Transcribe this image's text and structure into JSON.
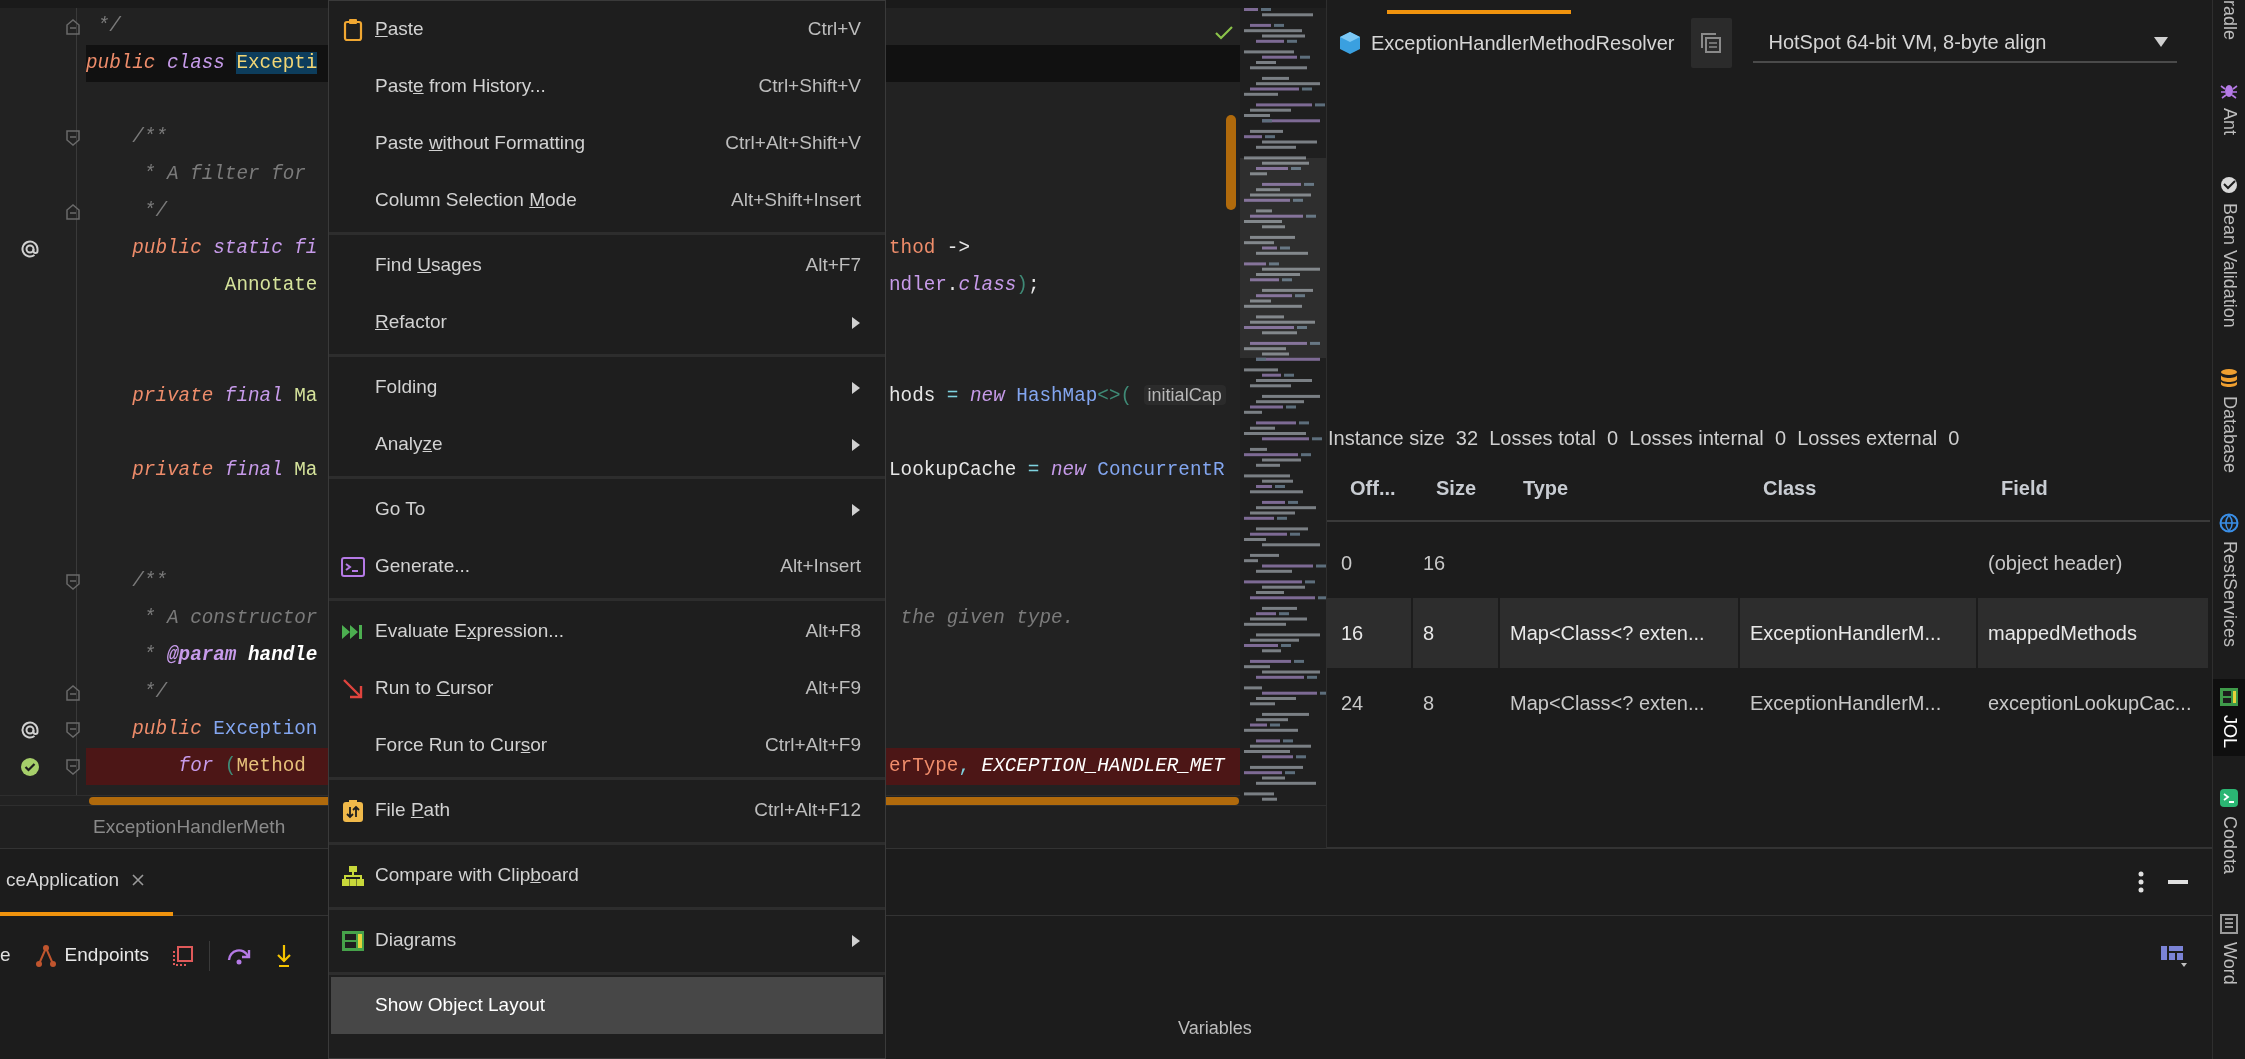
{
  "editor": {
    "lines": [
      {
        "left": [
          {
            "kind": "cm",
            "text": " */"
          }
        ],
        "current": false,
        "error": false,
        "fold": {
          "kind": "end"
        }
      },
      {
        "left": [
          {
            "kind": "kw",
            "text": "public "
          },
          {
            "kind": "mod",
            "text": "class "
          },
          {
            "kind": "sel",
            "text": "Excepti"
          }
        ],
        "current": true,
        "error": false
      },
      {
        "current": false,
        "error": false
      },
      {
        "left": [
          {
            "kind": "cm",
            "text": "    /**"
          }
        ],
        "current": false,
        "error": false,
        "fold": {
          "kind": "start"
        }
      },
      {
        "left": [
          {
            "kind": "cm",
            "text": "     * A filter for"
          }
        ],
        "current": false,
        "error": false
      },
      {
        "left": [
          {
            "kind": "cm",
            "text": "     */"
          }
        ],
        "current": false,
        "error": false,
        "fold": {
          "kind": "end"
        }
      },
      {
        "left": [
          {
            "kind": "kw",
            "text": "    public "
          },
          {
            "kind": "mod",
            "text": "static fi"
          }
        ],
        "right": [
          {
            "kind": "par",
            "text": "thod "
          },
          {
            "kind": "pl",
            "text": "->"
          }
        ],
        "current": false,
        "error": false,
        "gutter": {
          "kind": "annotation"
        }
      },
      {
        "left": [
          {
            "kind": "ann",
            "text": "            Annotate"
          }
        ],
        "right": [
          {
            "kind": "pv",
            "text": "ndler"
          },
          {
            "kind": "pl",
            "text": "."
          },
          {
            "kind": "mod",
            "text": "class"
          },
          {
            "kind": "br",
            "text": ")"
          },
          {
            "kind": "pl",
            "text": ";"
          }
        ],
        "current": false,
        "error": false
      },
      {
        "current": false,
        "error": false
      },
      {
        "current": false,
        "error": false
      },
      {
        "left": [
          {
            "kind": "kw",
            "text": "    private "
          },
          {
            "kind": "mod",
            "text": "final "
          },
          {
            "kind": "ann",
            "text": "Ma"
          }
        ],
        "right": [
          {
            "kind": "pl",
            "text": "hods "
          },
          {
            "kind": "op",
            "text": "= "
          },
          {
            "kind": "mod",
            "text": "new "
          },
          {
            "kind": "cls",
            "text": "HashMap"
          },
          {
            "kind": "br",
            "text": "<>( "
          },
          {
            "kind": "inl",
            "text": "initialCap"
          }
        ],
        "current": false,
        "error": false
      },
      {
        "current": false,
        "error": false
      },
      {
        "left": [
          {
            "kind": "kw",
            "text": "    private "
          },
          {
            "kind": "mod",
            "text": "final "
          },
          {
            "kind": "ann",
            "text": "Ma"
          }
        ],
        "right": [
          {
            "kind": "pl",
            "text": "LookupCache "
          },
          {
            "kind": "op",
            "text": "= "
          },
          {
            "kind": "mod",
            "text": "new "
          },
          {
            "kind": "cls",
            "text": "ConcurrentR"
          }
        ],
        "current": false,
        "error": false
      },
      {
        "current": false,
        "error": false
      },
      {
        "current": false,
        "error": false
      },
      {
        "left": [
          {
            "kind": "cm",
            "text": "    /**"
          }
        ],
        "current": false,
        "error": false,
        "fold": {
          "kind": "start"
        }
      },
      {
        "left": [
          {
            "kind": "cm",
            "text": "     * A constructor"
          }
        ],
        "right": [
          {
            "kind": "cm",
            "text": " the given type."
          }
        ],
        "current": false,
        "error": false
      },
      {
        "left": [
          {
            "kind": "cm",
            "text": "     * "
          },
          {
            "kind": "tag",
            "text": "@param "
          },
          {
            "kind": "pn",
            "text": "handle"
          }
        ],
        "current": false,
        "error": false
      },
      {
        "left": [
          {
            "kind": "cm",
            "text": "     */"
          }
        ],
        "current": false,
        "error": false,
        "fold": {
          "kind": "end"
        }
      },
      {
        "left": [
          {
            "kind": "kw",
            "text": "    public "
          },
          {
            "kind": "cls",
            "text": "Exception"
          }
        ],
        "current": false,
        "error": false,
        "gutter": {
          "kind": "annotation"
        },
        "fold": {
          "kind": "start"
        }
      },
      {
        "left": [
          {
            "kind": "mod",
            "text": "        for "
          },
          {
            "kind": "br",
            "text": "("
          },
          {
            "kind": "tyy",
            "text": "Method "
          }
        ],
        "right": [
          {
            "kind": "par",
            "text": "erType"
          },
          {
            "kind": "op",
            "text": ", "
          },
          {
            "kind": "cst",
            "text": "EXCEPTION_HANDLER_MET"
          }
        ],
        "current": false,
        "error": true,
        "gutter": {
          "kind": "check"
        },
        "fold": {
          "kind": "start"
        }
      }
    ],
    "breadcrumb": "ExceptionHandlerMeth"
  },
  "context_menu": {
    "items": [
      {
        "kind": "item",
        "label_parts": [
          {
            "text": "P",
            "underlined": true
          },
          {
            "text": "aste",
            "underlined": false
          }
        ],
        "shortcut": "Ctrl+V",
        "submenu": false,
        "selected": false
      },
      {
        "kind": "item",
        "label_parts": [
          {
            "text": "Past",
            "underlined": false
          },
          {
            "text": "e",
            "underlined": true
          },
          {
            "text": " from History...",
            "underlined": false
          }
        ],
        "shortcut": "Ctrl+Shift+V",
        "submenu": false,
        "selected": false
      },
      {
        "kind": "item",
        "label_parts": [
          {
            "text": "Paste ",
            "underlined": false
          },
          {
            "text": "w",
            "underlined": true
          },
          {
            "text": "ithout Formatting",
            "underlined": false
          }
        ],
        "shortcut": "Ctrl+Alt+Shift+V",
        "submenu": false,
        "selected": false
      },
      {
        "kind": "item",
        "label_parts": [
          {
            "text": "Column Selection ",
            "underlined": false
          },
          {
            "text": "M",
            "underlined": true
          },
          {
            "text": "ode",
            "underlined": false
          }
        ],
        "shortcut": "Alt+Shift+Insert",
        "submenu": false,
        "selected": false
      },
      {
        "kind": "separator"
      },
      {
        "kind": "item",
        "label_parts": [
          {
            "text": "Find ",
            "underlined": false
          },
          {
            "text": "U",
            "underlined": true
          },
          {
            "text": "sages",
            "underlined": false
          }
        ],
        "shortcut": "Alt+F7",
        "submenu": false,
        "selected": false
      },
      {
        "kind": "item",
        "label_parts": [
          {
            "text": "R",
            "underlined": true
          },
          {
            "text": "efactor",
            "underlined": false
          }
        ],
        "submenu": true,
        "selected": false
      },
      {
        "kind": "separator"
      },
      {
        "kind": "item",
        "label_parts": [
          {
            "text": "Folding",
            "underlined": false
          }
        ],
        "submenu": true,
        "selected": false
      },
      {
        "kind": "item",
        "label_parts": [
          {
            "text": "Analy",
            "underlined": false
          },
          {
            "text": "z",
            "underlined": true
          },
          {
            "text": "e",
            "underlined": false
          }
        ],
        "submenu": true,
        "selected": false
      },
      {
        "kind": "separator"
      },
      {
        "kind": "item",
        "label_parts": [
          {
            "text": "Go To",
            "underlined": false
          }
        ],
        "submenu": true,
        "selected": false
      },
      {
        "kind": "item",
        "label_parts": [
          {
            "text": "Generate...",
            "underlined": false
          }
        ],
        "shortcut": "Alt+Insert",
        "submenu": false,
        "selected": false
      },
      {
        "kind": "separator"
      },
      {
        "kind": "item",
        "label_parts": [
          {
            "text": "Evaluate E",
            "underlined": false
          },
          {
            "text": "x",
            "underlined": true
          },
          {
            "text": "pression...",
            "underlined": false
          }
        ],
        "shortcut": "Alt+F8",
        "submenu": false,
        "selected": false
      },
      {
        "kind": "item",
        "label_parts": [
          {
            "text": "Run to ",
            "underlined": false
          },
          {
            "text": "C",
            "underlined": true
          },
          {
            "text": "ursor",
            "underlined": false
          }
        ],
        "shortcut": "Alt+F9",
        "submenu": false,
        "selected": false
      },
      {
        "kind": "item",
        "label_parts": [
          {
            "text": "Force Run to Cur",
            "underlined": false
          },
          {
            "text": "s",
            "underlined": true
          },
          {
            "text": "or",
            "underlined": false
          }
        ],
        "shortcut": "Ctrl+Alt+F9",
        "submenu": false,
        "selected": false
      },
      {
        "kind": "separator"
      },
      {
        "kind": "item",
        "label_parts": [
          {
            "text": "File ",
            "underlined": false
          },
          {
            "text": "P",
            "underlined": true
          },
          {
            "text": "ath",
            "underlined": false
          }
        ],
        "shortcut": "Ctrl+Alt+F12",
        "submenu": false,
        "selected": false
      },
      {
        "kind": "separator"
      },
      {
        "kind": "item",
        "label_parts": [
          {
            "text": "Compare with Clip",
            "underlined": false
          },
          {
            "text": "b",
            "underlined": true
          },
          {
            "text": "oard",
            "underlined": false
          }
        ],
        "submenu": false,
        "selected": false
      },
      {
        "kind": "separator"
      },
      {
        "kind": "item",
        "label_parts": [
          {
            "text": "Diagrams",
            "underlined": false
          }
        ],
        "submenu": true,
        "selected": false
      },
      {
        "kind": "separator"
      },
      {
        "kind": "item",
        "label_parts": [
          {
            "text": "Show Object Layout",
            "underlined": false
          }
        ],
        "submenu": false,
        "selected": true
      }
    ]
  },
  "object_layout": {
    "class_name": "ExceptionHandlerMethodResolver",
    "vm_mode": "HotSpot 64-bit VM, 8-byte align",
    "summary": "Instance size  32  Losses total  0  Losses internal  0  Losses external  0",
    "table": {
      "columns": [
        "Off...",
        "Size",
        "Type",
        "Class",
        "Field"
      ],
      "rows": [
        {
          "cells": [
            "0",
            "16",
            null,
            null,
            "(object header)"
          ],
          "selected": false
        },
        {
          "cells": [
            "16",
            "8",
            "Map<Class<? exten...",
            "ExceptionHandlerM...",
            "mappedMethods"
          ],
          "selected": true
        },
        {
          "cells": [
            "24",
            "8",
            "Map<Class<? exten...",
            "ExceptionHandlerM...",
            "exceptionLookupCac..."
          ],
          "selected": false
        }
      ]
    }
  },
  "bottom_panel": {
    "tab": "ceApplication",
    "toolbar_cut_label": "e",
    "endpoints": "Endpoints",
    "variables": "Variables"
  },
  "side_tools": [
    {
      "label": "radle",
      "selected": false
    },
    {
      "label": "Ant",
      "selected": false
    },
    {
      "label": "Bean Validation",
      "selected": false
    },
    {
      "label": "Database",
      "selected": false
    },
    {
      "label": "RestServices",
      "selected": false
    },
    {
      "label": "JOL",
      "selected": true
    },
    {
      "label": "Codota",
      "selected": false
    },
    {
      "label": "Word",
      "selected": false
    }
  ]
}
